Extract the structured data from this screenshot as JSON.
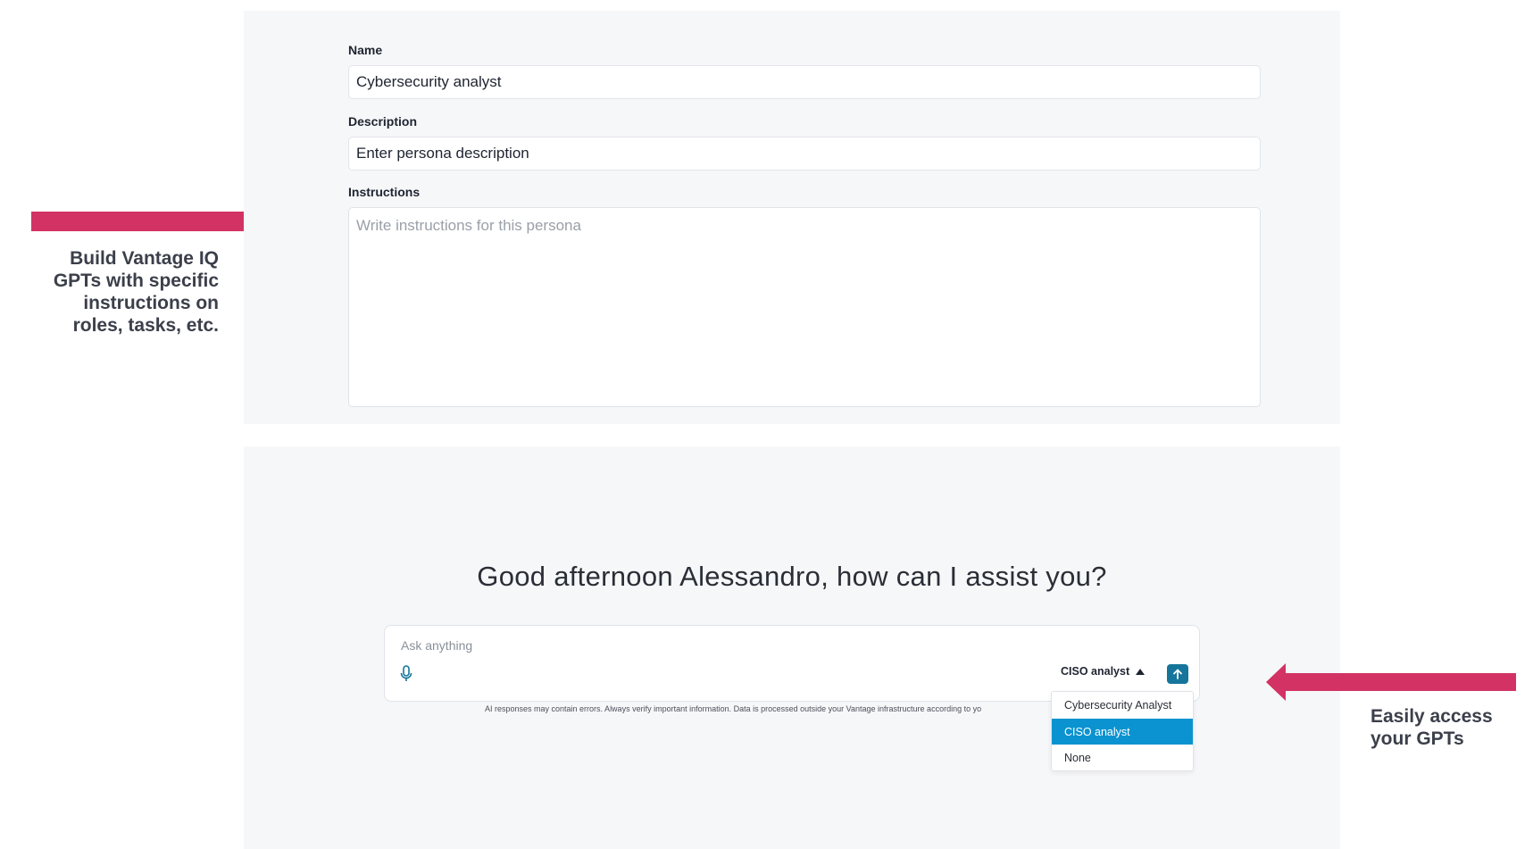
{
  "persona_form": {
    "name_label": "Name",
    "name_value": "Cybersecurity analyst",
    "description_label": "Description",
    "description_value": "Enter persona description",
    "instructions_label": "Instructions",
    "instructions_placeholder": "Write instructions for this persona"
  },
  "callouts": {
    "left_lines": [
      "Build Vantage IQ",
      "GPTs with specific",
      "instructions on",
      "roles, tasks, etc."
    ],
    "right_lines": [
      "Easily access",
      "your GPTs"
    ],
    "arrow_color": "#d23364"
  },
  "chat": {
    "greeting": "Good afternoon Alessandro, how can I assist you?",
    "placeholder": "Ask anything",
    "persona_selected": "CISO analyst",
    "disclaimer": "AI responses may contain errors. Always verify important information. Data is processed outside your Vantage infrastructure according to yo",
    "send_color": "#15759b"
  },
  "persona_dropdown": {
    "options": [
      "Cybersecurity Analyst",
      "CISO analyst",
      "None"
    ],
    "selected_index": 1,
    "selected_color": "#0a93d0"
  },
  "icons": {
    "mic": "microphone-icon",
    "send": "arrow-up-icon",
    "caret": "caret-up-icon"
  }
}
